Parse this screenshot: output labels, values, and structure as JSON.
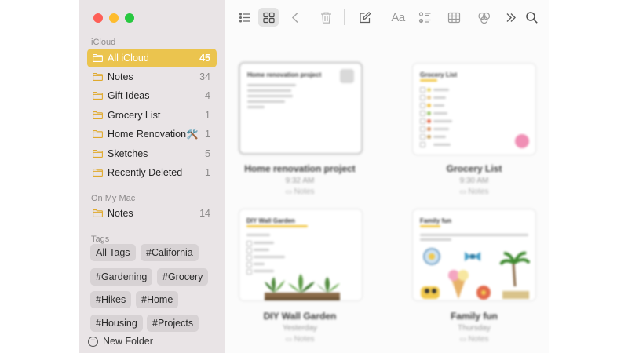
{
  "sidebar": {
    "icloud_label": "iCloud",
    "icloud_folders": [
      {
        "label": "All iCloud",
        "count": "45",
        "selected": true
      },
      {
        "label": "Notes",
        "count": "34"
      },
      {
        "label": "Gift Ideas",
        "count": "4"
      },
      {
        "label": "Grocery List",
        "count": "1"
      },
      {
        "label": "Home Renovation🛠️",
        "count": "1"
      },
      {
        "label": "Sketches",
        "count": "5"
      },
      {
        "label": "Recently Deleted",
        "count": "1"
      }
    ],
    "mac_label": "On My Mac",
    "mac_folders": [
      {
        "label": "Notes",
        "count": "14"
      }
    ],
    "tags_label": "Tags",
    "tags": [
      "All Tags",
      "#California",
      "#Gardening",
      "#Grocery",
      "#Hikes",
      "#Home",
      "#Housing",
      "#Projects"
    ],
    "new_folder_label": "New Folder"
  },
  "toolbar": {
    "format_label": "Aa",
    "active_view": "gallery"
  },
  "notes": [
    {
      "title": "Home renovation project",
      "time": "9:32 AM",
      "folder": "Notes",
      "selected": true
    },
    {
      "title": "Grocery List",
      "time": "9:30 AM",
      "folder": "Notes"
    },
    {
      "title": "DIY Wall Garden",
      "time": "Yesterday",
      "folder": "Notes"
    },
    {
      "title": "Family fun",
      "time": "Thursday",
      "folder": "Notes"
    }
  ],
  "colors": {
    "accent": "#ebc44e",
    "sidebar_bg": "#e9e4e6",
    "folder_icon": "#e0a92c"
  }
}
